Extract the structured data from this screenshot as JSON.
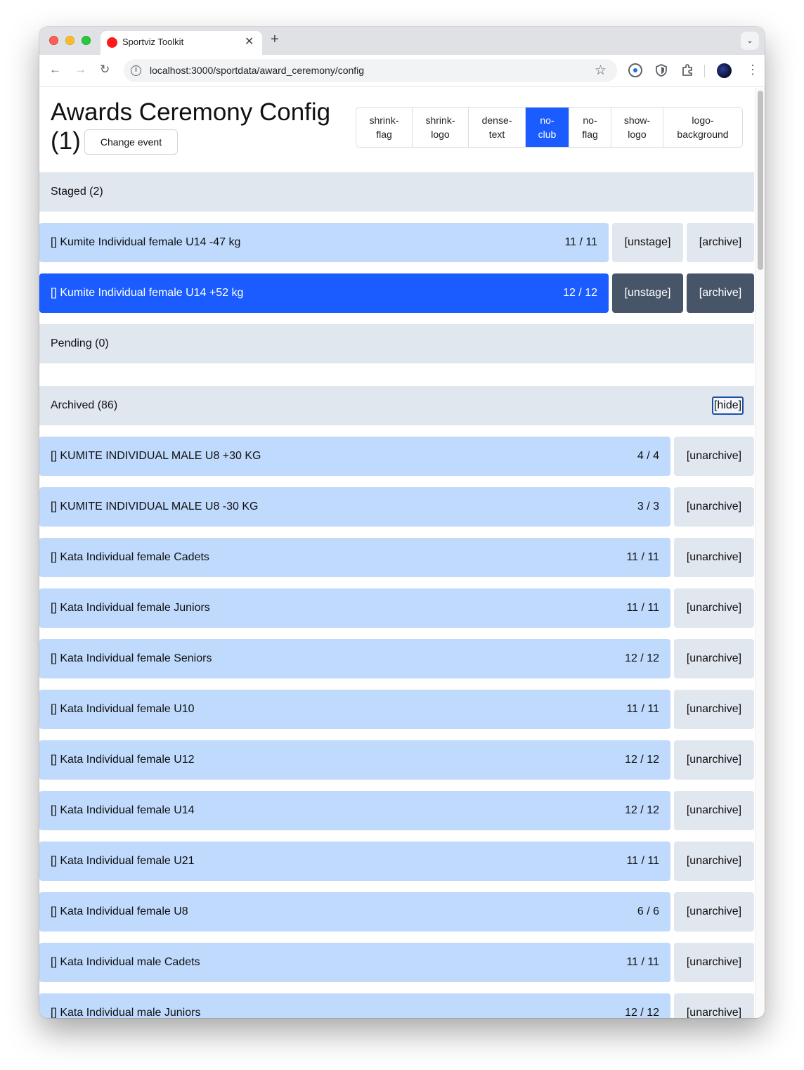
{
  "browser": {
    "tab_title": "Sportviz Toolkit",
    "tab_close": "✕",
    "new_tab": "+",
    "url": "localhost:3000/sportdata/award_ceremony/config"
  },
  "page": {
    "title": "Awards Ceremony Config (1)",
    "change_event_label": "Change event",
    "toggles": [
      {
        "label": "shrink-\nflag",
        "active": false
      },
      {
        "label": "shrink-\nlogo",
        "active": false
      },
      {
        "label": "dense-\ntext",
        "active": false
      },
      {
        "label": "no-\nclub",
        "active": true
      },
      {
        "label": "no-\nflag",
        "active": false
      },
      {
        "label": "show-\nlogo",
        "active": false
      },
      {
        "label": "logo-\nbackground",
        "active": false
      }
    ]
  },
  "staged": {
    "header": "Staged (2)",
    "unstage_label": "[unstage]",
    "archive_label": "[archive]",
    "rows": [
      {
        "name": "[] Kumite Individual female U14 -47 kg",
        "count": "11 / 11",
        "selected": false
      },
      {
        "name": "[] Kumite Individual female U14 +52 kg",
        "count": "12 / 12",
        "selected": true
      }
    ]
  },
  "pending": {
    "header": "Pending (0)"
  },
  "archived": {
    "header": "Archived (86)",
    "hide_label": "[hide]",
    "unarchive_label": "[unarchive]",
    "rows": [
      {
        "name": "[] KUMITE INDIVIDUAL MALE U8 +30 KG",
        "count": "4 / 4"
      },
      {
        "name": "[] KUMITE INDIVIDUAL MALE U8 -30 KG",
        "count": "3 / 3"
      },
      {
        "name": "[] Kata Individual female Cadets",
        "count": "11 / 11"
      },
      {
        "name": "[] Kata Individual female Juniors",
        "count": "11 / 11"
      },
      {
        "name": "[] Kata Individual female Seniors",
        "count": "12 / 12"
      },
      {
        "name": "[] Kata Individual female U10",
        "count": "11 / 11"
      },
      {
        "name": "[] Kata Individual female U12",
        "count": "12 / 12"
      },
      {
        "name": "[] Kata Individual female U14",
        "count": "12 / 12"
      },
      {
        "name": "[] Kata Individual female U21",
        "count": "11 / 11"
      },
      {
        "name": "[] Kata Individual female U8",
        "count": "6 / 6"
      },
      {
        "name": "[] Kata Individual male Cadets",
        "count": "11 / 11"
      },
      {
        "name": "[] Kata Individual male Juniors",
        "count": "12 / 12"
      }
    ]
  },
  "colors": {
    "accent": "#1a5cff",
    "row_bg": "#bfdafc",
    "section_bg": "#e1e7ef",
    "dark_button": "#475569"
  }
}
